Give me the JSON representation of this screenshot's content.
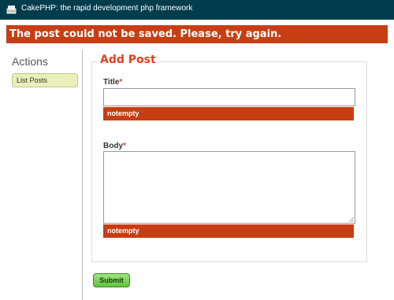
{
  "header": {
    "title": "CakePHP: the rapid development php framework",
    "logo_icon": "cake-logo-icon"
  },
  "flash": {
    "message": "The post could not be saved. Please, try again."
  },
  "sidebar": {
    "heading": "Actions",
    "items": [
      {
        "label": "List Posts"
      }
    ]
  },
  "form": {
    "legend": "Add Post",
    "fields": {
      "title": {
        "label": "Title",
        "required_mark": "*",
        "value": "",
        "error": "notempty"
      },
      "body": {
        "label": "Body",
        "required_mark": "*",
        "value": "",
        "error": "notempty"
      }
    },
    "submit_label": "Submit"
  },
  "colors": {
    "header_bg": "#003d4c",
    "error_bg": "#c73e14",
    "legend": "#e23e1d",
    "action_button_bg": "#e8efb9",
    "submit_bg": "#62c23f"
  }
}
